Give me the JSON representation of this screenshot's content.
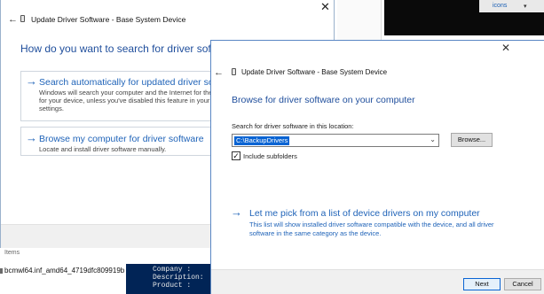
{
  "background": {
    "top_right_link": "icons",
    "explorer_items_label": "Items",
    "explorer_file": "bcmwl64.inf_amd64_4719dfc809919b",
    "powershell_lines": [
      "Company :",
      "Description:",
      "Product :"
    ]
  },
  "back_dialog": {
    "back_glyph": "←",
    "title": "Update Driver Software - Base System Device",
    "close_glyph": "✕",
    "heading": "How do you want to search for driver software?",
    "option_auto": {
      "arrow": "→",
      "label": "Search automatically for updated driver softw",
      "desc_lines": [
        "Windows will search your computer and the Internet for the",
        "for your device, unless you've disabled this feature in your",
        "settings."
      ]
    },
    "option_browse": {
      "arrow": "→",
      "label": "Browse my computer for driver software",
      "desc": "Locate and install driver software manually."
    }
  },
  "front_dialog": {
    "close_glyph": "✕",
    "back_glyph": "←",
    "title": "Update Driver Software - Base System Device",
    "heading": "Browse for driver software on your computer",
    "search_label": "Search for driver software in this location:",
    "path_value": "C:\\BackupDrivers",
    "dropdown_glyph": "⌄",
    "browse_label": "Browse...",
    "include_subfolders": {
      "checked_glyph": "✓",
      "label": "Include subfolders"
    },
    "pick_option": {
      "arrow": "→",
      "label": "Let me pick from a list of device drivers on my computer",
      "desc_lines": [
        "This list will show installed driver software compatible with the device, and all driver",
        "software in the same category as the device."
      ]
    },
    "next_label": "Next",
    "cancel_label": "Cancel"
  },
  "colors": {
    "accent_blue": "#1f63b8",
    "heading_blue": "#1f4e9c",
    "selection": "#0a64d3",
    "footer_gray": "#f0f0f0",
    "powershell_bg": "#012456"
  }
}
